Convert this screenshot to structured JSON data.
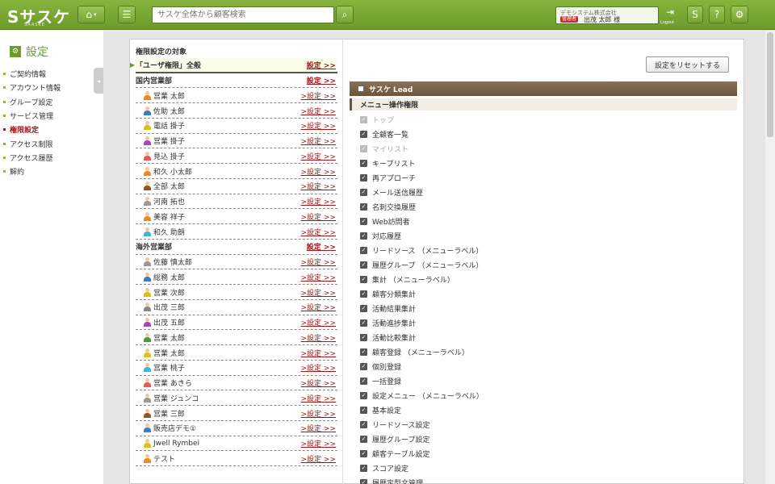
{
  "header": {
    "logo": "Sサスケ",
    "logo_sub": "SAASKE",
    "search_placeholder": "サスケ全体から顧客検索",
    "company": "デモシステム株式会社",
    "role_badge": "管理者",
    "user_name": "出茂 太郎 様",
    "logout_label": "Logout"
  },
  "sidebar": {
    "title": "設定",
    "items": [
      {
        "label": "ご契約情報",
        "active": false
      },
      {
        "label": "アカウント情報",
        "active": false
      },
      {
        "label": "グループ設定",
        "active": false
      },
      {
        "label": "サービス管理",
        "active": false
      },
      {
        "label": "権限設定",
        "active": true
      },
      {
        "label": "アクセス制限",
        "active": false
      },
      {
        "label": "アクセス履歴",
        "active": false
      },
      {
        "label": "解約",
        "active": false
      }
    ]
  },
  "targets": {
    "title": "権限設定の対象",
    "link_label": "設定 >>",
    "user_link_label": ">設定 >>",
    "rows": [
      {
        "type": "all",
        "label": "「ユーザ権限」全般"
      },
      {
        "type": "grp",
        "label": "国内営業部"
      },
      {
        "type": "user",
        "label": "営業 太郎",
        "color": "#e98b2a"
      },
      {
        "type": "user",
        "label": "佐助 太郎",
        "color": "#3f7ac4"
      },
      {
        "type": "user",
        "label": "電話 掛子",
        "color": "#d6c219"
      },
      {
        "type": "user",
        "label": "営業 掛子",
        "color": "#a04ac0"
      },
      {
        "type": "user",
        "label": "見込 掛子",
        "color": "#e35a5a"
      },
      {
        "type": "user",
        "label": "和久 小太郎",
        "color": "#e98b2a"
      },
      {
        "type": "user",
        "label": "全部 太郎",
        "color": "#8b5a2b"
      },
      {
        "type": "user",
        "label": "河南 拓也",
        "color": "#999999"
      },
      {
        "type": "user",
        "label": "美容 祥子",
        "color": "#e98b2a"
      },
      {
        "type": "user",
        "label": "和久 助朗",
        "color": "#3fb8d8"
      },
      {
        "type": "grp",
        "label": "海外営業部"
      },
      {
        "type": "user",
        "label": "佐藤 慎太郎",
        "color": "#999999"
      },
      {
        "type": "user",
        "label": "総務 太郎",
        "color": "#3f7ac4"
      },
      {
        "type": "user",
        "label": "営業 次郎",
        "color": "#d6c219"
      },
      {
        "type": "user",
        "label": "出茂 三郎",
        "color": "#888888"
      },
      {
        "type": "user",
        "label": "出茂 五郎",
        "color": "#a04ac0"
      },
      {
        "type": "user",
        "label": "営業 太郎",
        "color": "#4a9a3a"
      },
      {
        "type": "user",
        "label": "営業 太郎",
        "color": "#d6c219"
      },
      {
        "type": "user",
        "label": "営業 桃子",
        "color": "#3fb8d8"
      },
      {
        "type": "user",
        "label": "営業 あきら",
        "color": "#e35a5a"
      },
      {
        "type": "user",
        "label": "営業 ジュンコ",
        "color": "#999999"
      },
      {
        "type": "user",
        "label": "営業 三郎",
        "color": "#8b5a2b"
      },
      {
        "type": "user",
        "label": "販売店デモ①",
        "color": "#3f7ac4"
      },
      {
        "type": "user",
        "label": "Jwell Rymbei",
        "color": "#d6c219"
      },
      {
        "type": "user",
        "label": "テスト",
        "color": "#e98b2a"
      }
    ]
  },
  "perms": {
    "reset_label": "設定をリセットする",
    "section_title": "サスケ Lead",
    "subsection_title": "メニュー操作権限",
    "items": [
      {
        "label": "トップ",
        "disabled": true
      },
      {
        "label": "全顧客一覧",
        "disabled": false
      },
      {
        "label": "マイリスト",
        "disabled": true
      },
      {
        "label": "キープリスト",
        "disabled": false
      },
      {
        "label": "再アプローチ",
        "disabled": false
      },
      {
        "label": "メール送信履歴",
        "disabled": false
      },
      {
        "label": "名刺交換履歴",
        "disabled": false
      },
      {
        "label": "Web訪問者",
        "disabled": false
      },
      {
        "label": "対応履歴",
        "disabled": false
      },
      {
        "label": "リードソース （メニューラベル）",
        "disabled": false
      },
      {
        "label": "履歴グループ （メニューラベル）",
        "disabled": false
      },
      {
        "label": "集計 （メニューラベル）",
        "disabled": false
      },
      {
        "label": "顧客分類集計",
        "disabled": false
      },
      {
        "label": "活動結果集計",
        "disabled": false
      },
      {
        "label": "活動進捗集計",
        "disabled": false
      },
      {
        "label": "活動比較集計",
        "disabled": false
      },
      {
        "label": "顧客登録 （メニューラベル）",
        "disabled": false
      },
      {
        "label": "個別登録",
        "disabled": false
      },
      {
        "label": "一括登録",
        "disabled": false
      },
      {
        "label": "設定メニュー （メニューラベル）",
        "disabled": false
      },
      {
        "label": "基本設定",
        "disabled": false
      },
      {
        "label": "リードソース設定",
        "disabled": false
      },
      {
        "label": "履歴グループ設定",
        "disabled": false
      },
      {
        "label": "顧客テーブル設定",
        "disabled": false
      },
      {
        "label": "スコア設定",
        "disabled": false
      },
      {
        "label": "履歴定型文管理",
        "disabled": false
      }
    ]
  }
}
